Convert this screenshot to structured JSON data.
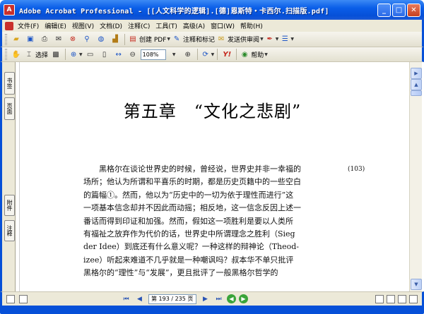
{
  "window": {
    "title": "Adobe Acrobat Professional - [[人文科学的逻辑].[德]恩斯特・卡西尔.扫描版.pdf]",
    "app_icon": "A"
  },
  "menu": [
    "文件(F)",
    "编辑(E)",
    "视图(V)",
    "文档(D)",
    "注释(C)",
    "工具(T)",
    "高级(A)",
    "窗口(W)",
    "帮助(H)"
  ],
  "toolbar1": {
    "create_pdf": "创建 PDF",
    "comment_markup": "注释和标记",
    "send_review": "发送供审阅"
  },
  "toolbar2": {
    "select": "选择",
    "zoom": "108%",
    "help": "帮助"
  },
  "nav_tabs": [
    "书签",
    "页面",
    "附件",
    "注释"
  ],
  "document": {
    "chapter_title": "第五章　“文化之悲剧”",
    "margin_note": "(103)",
    "lines": [
      "黑格尔在谈论世界史的时候，曾经说，世界史并非一幸福的",
      "场所；他认为所谓和平喜乐的时期，都是历史页籍中的一些空白",
      "的篇幅①。然而，他以为“历史中的一切为依于理性而进行”这",
      "一项基本信念却并不因此而动摇；相反地，这一信念反因上述一",
      "番话而得到印证和加强。然而，假如这一项胜利是要以人类所",
      "有福祉之放弃作为代价的话，世界史中所谓理念之胜利（Sieg",
      "der Idee）到底还有什么意义呢？一种这样的辩神论（Theod-",
      "izee）听起来难道不几乎就是一种嘲讽吗？叔本华不单只批评",
      "黑格尔的“理性”与“发展”，更且批评了一般黑格尔哲学的"
    ]
  },
  "status": {
    "page_label": "第 193 / 235 页"
  }
}
